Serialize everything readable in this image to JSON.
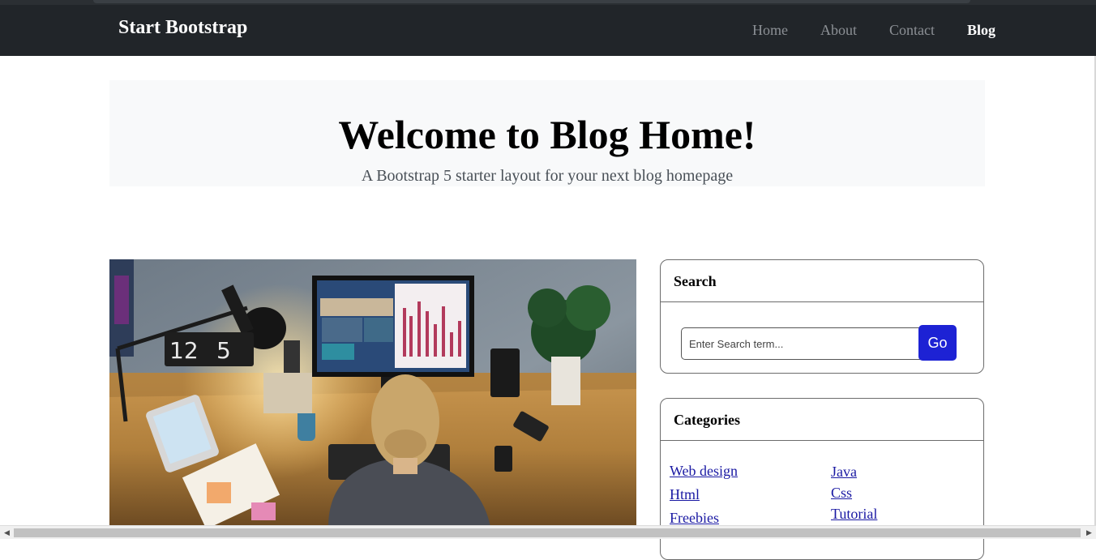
{
  "navbar": {
    "brand": "Start Bootstrap",
    "links": [
      {
        "label": "Home",
        "active": false
      },
      {
        "label": "About",
        "active": false
      },
      {
        "label": "Contact",
        "active": false
      },
      {
        "label": "Blog",
        "active": true
      }
    ]
  },
  "hero": {
    "title": "Welcome to Blog Home!",
    "subtitle": "A Bootstrap 5 starter layout for your next blog homepage"
  },
  "featured_post": {
    "image_alt_icon": "desk-workspace-image"
  },
  "search_widget": {
    "header": "Search",
    "placeholder": "Enter Search term...",
    "button_label": "Go",
    "button_color": "#1d22d4"
  },
  "categories_widget": {
    "header": "Categories",
    "column1": [
      "Web design",
      "Html",
      "Freebies"
    ],
    "column2": [
      "Java",
      "Css",
      "Tutorial"
    ]
  },
  "colors": {
    "navbar_bg": "#212529",
    "hero_bg": "#f8f9fa",
    "link": "#1a19a3"
  }
}
